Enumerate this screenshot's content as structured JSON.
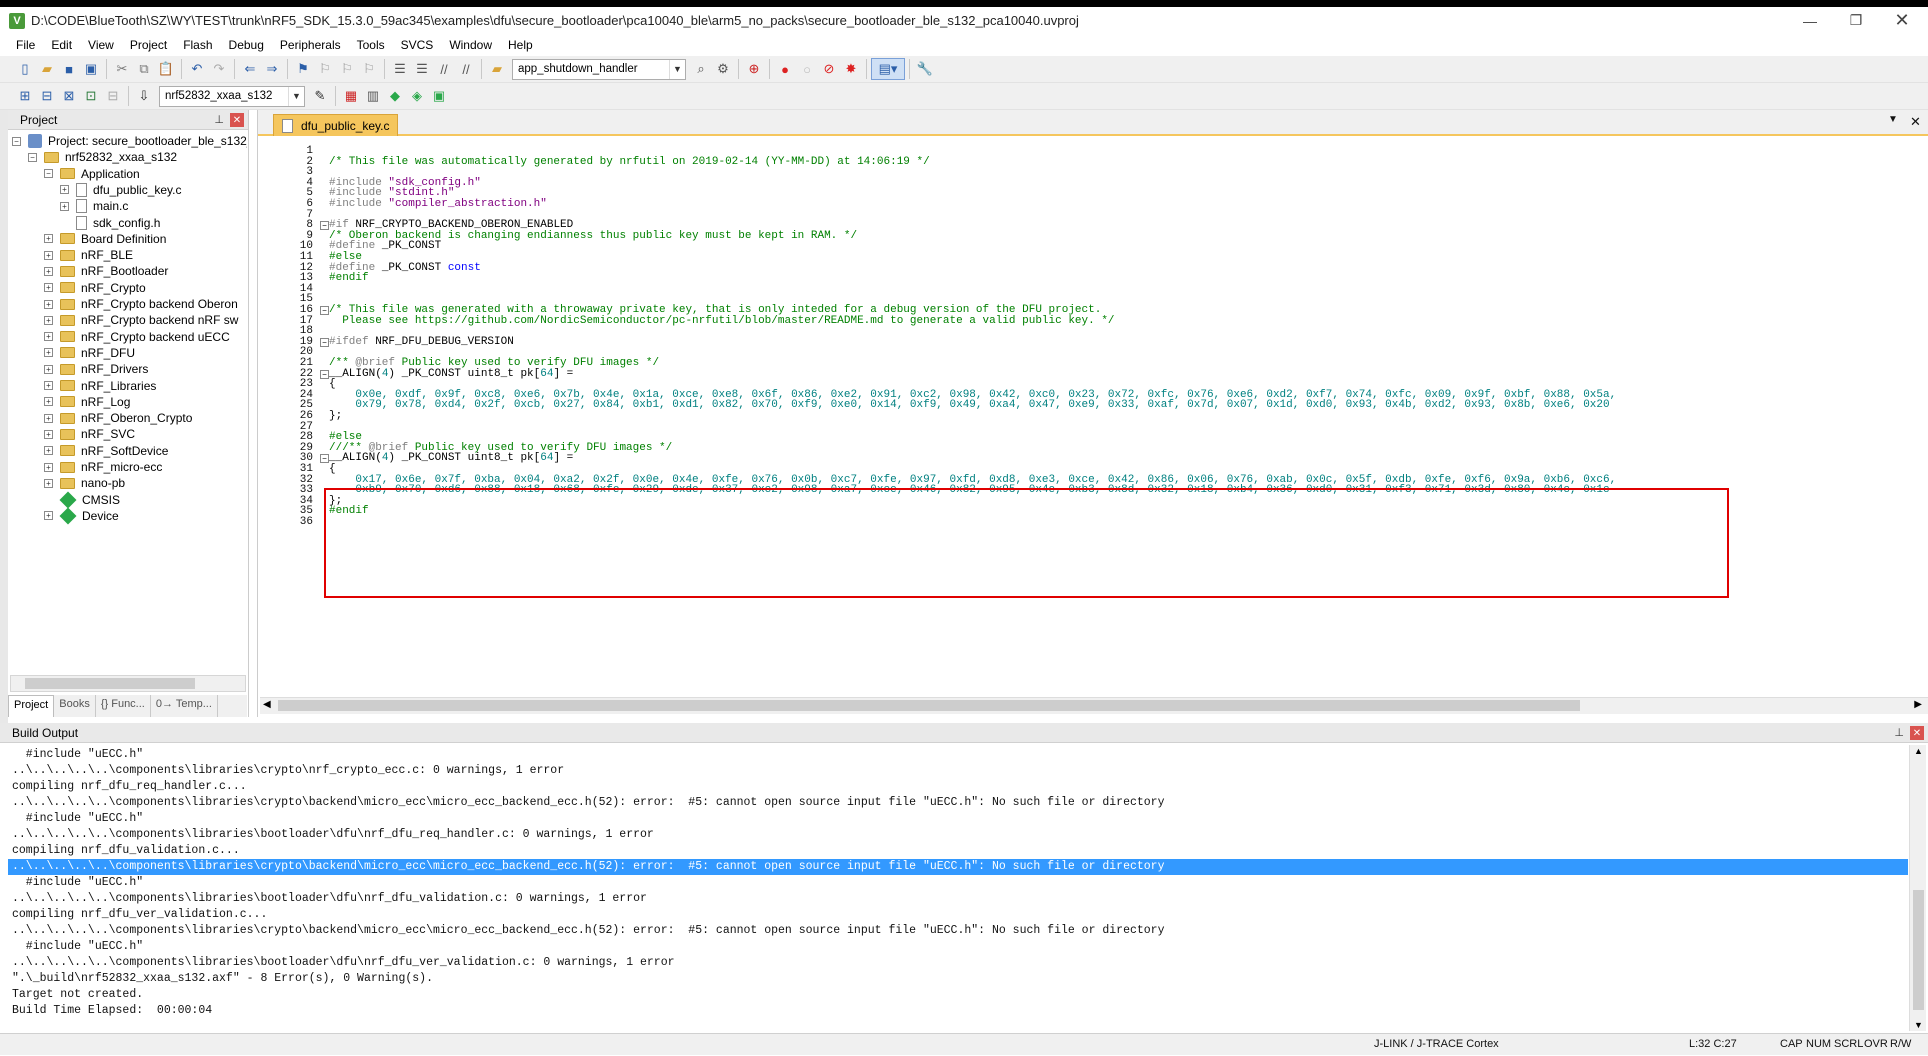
{
  "window": {
    "title": "D:\\CODE\\BlueTooth\\SZ\\WY\\TEST\\trunk\\nRF5_SDK_15.3.0_59ac345\\examples\\dfu\\secure_bootloader\\pca10040_ble\\arm5_no_packs\\secure_bootloader_ble_s132_pca10040.uvproj",
    "app_icon": "V"
  },
  "menu": [
    "File",
    "Edit",
    "View",
    "Project",
    "Flash",
    "Debug",
    "Peripherals",
    "Tools",
    "SVCS",
    "Window",
    "Help"
  ],
  "toolbar": {
    "function_combo": "app_shutdown_handler",
    "target_combo": "nrf52832_xxaa_s132"
  },
  "project_pane": {
    "title": "Project",
    "tree": [
      {
        "label": "Project: secure_bootloader_ble_s132_",
        "level": 0,
        "kind": "project",
        "expanded": true
      },
      {
        "label": "nrf52832_xxaa_s132",
        "level": 1,
        "kind": "target",
        "expanded": true
      },
      {
        "label": "Application",
        "level": 2,
        "kind": "folder",
        "expanded": true
      },
      {
        "label": "dfu_public_key.c",
        "level": 3,
        "kind": "file",
        "expand": true
      },
      {
        "label": "main.c",
        "level": 3,
        "kind": "file",
        "expand": true
      },
      {
        "label": "sdk_config.h",
        "level": 3,
        "kind": "file",
        "expand": false
      },
      {
        "label": "Board Definition",
        "level": 2,
        "kind": "folder"
      },
      {
        "label": "nRF_BLE",
        "level": 2,
        "kind": "folder"
      },
      {
        "label": "nRF_Bootloader",
        "level": 2,
        "kind": "folder"
      },
      {
        "label": "nRF_Crypto",
        "level": 2,
        "kind": "folder"
      },
      {
        "label": "nRF_Crypto backend Oberon",
        "level": 2,
        "kind": "folder"
      },
      {
        "label": "nRF_Crypto backend nRF sw",
        "level": 2,
        "kind": "folder"
      },
      {
        "label": "nRF_Crypto backend uECC",
        "level": 2,
        "kind": "folder"
      },
      {
        "label": "nRF_DFU",
        "level": 2,
        "kind": "folder"
      },
      {
        "label": "nRF_Drivers",
        "level": 2,
        "kind": "folder"
      },
      {
        "label": "nRF_Libraries",
        "level": 2,
        "kind": "folder"
      },
      {
        "label": "nRF_Log",
        "level": 2,
        "kind": "folder"
      },
      {
        "label": "nRF_Oberon_Crypto",
        "level": 2,
        "kind": "folder"
      },
      {
        "label": "nRF_SVC",
        "level": 2,
        "kind": "folder"
      },
      {
        "label": "nRF_SoftDevice",
        "level": 2,
        "kind": "folder"
      },
      {
        "label": "nRF_micro-ecc",
        "level": 2,
        "kind": "folder"
      },
      {
        "label": "nano-pb",
        "level": 2,
        "kind": "folder"
      },
      {
        "label": "CMSIS",
        "level": 2,
        "kind": "gem"
      },
      {
        "label": "Device",
        "level": 2,
        "kind": "gem-expand"
      }
    ],
    "tabs": [
      "Project",
      "Books",
      "{} Func...",
      "0→ Temp..."
    ]
  },
  "editor": {
    "tab_label": "dfu_public_key.c",
    "lines": [
      {
        "n": "1",
        "t": "",
        "c": ""
      },
      {
        "n": "2",
        "t": "/* This file was automatically generated by nrfutil on 2019-02-14 (YY-MM-DD) at 14:06:19 */",
        "c": "c-com"
      },
      {
        "n": "3",
        "t": "",
        "c": ""
      },
      {
        "n": "4",
        "t": "#include \"sdk_config.h\"",
        "c": "inc"
      },
      {
        "n": "5",
        "t": "#include \"stdint.h\"",
        "c": "inc"
      },
      {
        "n": "6",
        "t": "#include \"compiler_abstraction.h\"",
        "c": "inc"
      },
      {
        "n": "7",
        "t": "",
        "c": ""
      },
      {
        "n": "8",
        "t": "#if NRF_CRYPTO_BACKEND_OBERON_ENABLED",
        "c": "pp"
      },
      {
        "n": "9",
        "t": "/* Oberon backend is changing endianness thus public key must be kept in RAM. */",
        "c": "c-com"
      },
      {
        "n": "10",
        "t": "#define _PK_CONST",
        "c": "pp"
      },
      {
        "n": "11",
        "t": "#else",
        "c": "c-com"
      },
      {
        "n": "12",
        "t": "#define _PK_CONST const",
        "c": "ppkw"
      },
      {
        "n": "13",
        "t": "#endif",
        "c": "c-com"
      },
      {
        "n": "14",
        "t": "",
        "c": ""
      },
      {
        "n": "15",
        "t": "",
        "c": ""
      },
      {
        "n": "16",
        "t": "/* This file was generated with a throwaway private key, that is only inteded for a debug version of the DFU project.",
        "c": "c-com"
      },
      {
        "n": "17",
        "t": "  Please see https://github.com/NordicSemiconductor/pc-nrfutil/blob/master/README.md to generate a valid public key. */",
        "c": "c-com"
      },
      {
        "n": "18",
        "t": "",
        "c": ""
      },
      {
        "n": "19",
        "t": "#ifdef NRF_DFU_DEBUG_VERSION",
        "c": "pp"
      },
      {
        "n": "20",
        "t": "",
        "c": ""
      },
      {
        "n": "21",
        "t": "/** @brief Public key used to verify DFU images */",
        "c": "c-com"
      },
      {
        "n": "22",
        "t": "__ALIGN(4) _PK_CONST uint8_t pk[64] =",
        "c": "decl"
      },
      {
        "n": "23",
        "t": "{",
        "c": ""
      },
      {
        "n": "24",
        "t": "    0x0e, 0xdf, 0x9f, 0xc8, 0xe6, 0x7b, 0x4e, 0x1a, 0xce, 0xe8, 0x6f, 0x86, 0xe2, 0x91, 0xc2, 0x98, 0x42, 0xc0, 0x23, 0x72, 0xfc, 0x76, 0xe6, 0xd2, 0xf7, 0x74, 0xfc, 0x09, 0x9f, 0xbf, 0x88, 0x5a,",
        "c": "c-num"
      },
      {
        "n": "25",
        "t": "    0x79, 0x78, 0xd4, 0x2f, 0xcb, 0x27, 0x84, 0xb1, 0xd1, 0x82, 0x70, 0xf9, 0xe0, 0x14, 0xf9, 0x49, 0xa4, 0x47, 0xe9, 0x33, 0xaf, 0x7d, 0x07, 0x1d, 0xd0, 0x93, 0x4b, 0xd2, 0x93, 0x8b, 0xe6, 0x20",
        "c": "c-num"
      },
      {
        "n": "26",
        "t": "};",
        "c": ""
      },
      {
        "n": "27",
        "t": "",
        "c": ""
      },
      {
        "n": "28",
        "t": "#else",
        "c": "c-com"
      },
      {
        "n": "29",
        "t": "///** @brief Public key used to verify DFU images */",
        "c": "c-com"
      },
      {
        "n": "30",
        "t": "__ALIGN(4) _PK_CONST uint8_t pk[64] =",
        "c": "decl"
      },
      {
        "n": "31",
        "t": "{",
        "c": ""
      },
      {
        "n": "32",
        "t": "    0x17, 0x6e, 0x7f, 0xba, 0x04, 0xa2, 0x2f, 0x0e, 0x4e, 0xfe, 0x76, 0x0b, 0xc7, 0xfe, 0x97, 0xfd, 0xd8, 0xe3, 0xce, 0x42, 0x86, 0x06, 0x76, 0xab, 0x0c, 0x5f, 0xdb, 0xfe, 0xf6, 0x9a, 0xb6, 0xc6,",
        "c": "c-num"
      },
      {
        "n": "33",
        "t": "    0xb9, 0x70, 0xd6, 0x88, 0x18, 0x68, 0xfe, 0x29, 0xde, 0x37, 0xc2, 0x98, 0xa7, 0xce, 0x46, 0x82, 0x95, 0x4e, 0xb3, 0x8d, 0x32, 0x18, 0xb4, 0x36, 0xd0, 0x31, 0xf3, 0x71, 0x3d, 0x80, 0x4c, 0x1c",
        "c": "c-num"
      },
      {
        "n": "34",
        "t": "};",
        "c": ""
      },
      {
        "n": "35",
        "t": "#endif",
        "c": "c-com"
      },
      {
        "n": "36",
        "t": "",
        "c": ""
      }
    ]
  },
  "build_output": {
    "title": "Build Output",
    "lines": [
      {
        "t": "  #include \"uECC.h\"",
        "sel": false
      },
      {
        "t": "..\\..\\..\\..\\..\\components\\libraries\\crypto\\nrf_crypto_ecc.c: 0 warnings, 1 error",
        "sel": false
      },
      {
        "t": "compiling nrf_dfu_req_handler.c...",
        "sel": false
      },
      {
        "t": "..\\..\\..\\..\\..\\components\\libraries\\crypto\\backend\\micro_ecc\\micro_ecc_backend_ecc.h(52): error:  #5: cannot open source input file \"uECC.h\": No such file or directory",
        "sel": false
      },
      {
        "t": "  #include \"uECC.h\"",
        "sel": false
      },
      {
        "t": "..\\..\\..\\..\\..\\components\\libraries\\bootloader\\dfu\\nrf_dfu_req_handler.c: 0 warnings, 1 error",
        "sel": false
      },
      {
        "t": "compiling nrf_dfu_validation.c...",
        "sel": false
      },
      {
        "t": "..\\..\\..\\..\\..\\components\\libraries\\crypto\\backend\\micro_ecc\\micro_ecc_backend_ecc.h(52): error:  #5: cannot open source input file \"uECC.h\": No such file or directory",
        "sel": true
      },
      {
        "t": "  #include \"uECC.h\"",
        "sel": false
      },
      {
        "t": "..\\..\\..\\..\\..\\components\\libraries\\bootloader\\dfu\\nrf_dfu_validation.c: 0 warnings, 1 error",
        "sel": false
      },
      {
        "t": "compiling nrf_dfu_ver_validation.c...",
        "sel": false
      },
      {
        "t": "..\\..\\..\\..\\..\\components\\libraries\\crypto\\backend\\micro_ecc\\micro_ecc_backend_ecc.h(52): error:  #5: cannot open source input file \"uECC.h\": No such file or directory",
        "sel": false
      },
      {
        "t": "  #include \"uECC.h\"",
        "sel": false
      },
      {
        "t": "..\\..\\..\\..\\..\\components\\libraries\\bootloader\\dfu\\nrf_dfu_ver_validation.c: 0 warnings, 1 error",
        "sel": false
      },
      {
        "t": "\".\\_build\\nrf52832_xxaa_s132.axf\" - 8 Error(s), 0 Warning(s).",
        "sel": false
      },
      {
        "t": "Target not created.",
        "sel": false
      },
      {
        "t": "Build Time Elapsed:  00:00:04",
        "sel": false
      }
    ]
  },
  "status": {
    "debugger": "J-LINK / J-TRACE Cortex",
    "position": "L:32 C:27",
    "cap": "CAP",
    "num": "NUM",
    "scrl": "SCRL",
    "ovr": "OVR",
    "rw": "R/W"
  },
  "colors": {
    "highlight": "#3399ff",
    "redbox": "#e00000",
    "tab_active": "#f5c65d",
    "comment": "#008000",
    "number": "#008080"
  }
}
